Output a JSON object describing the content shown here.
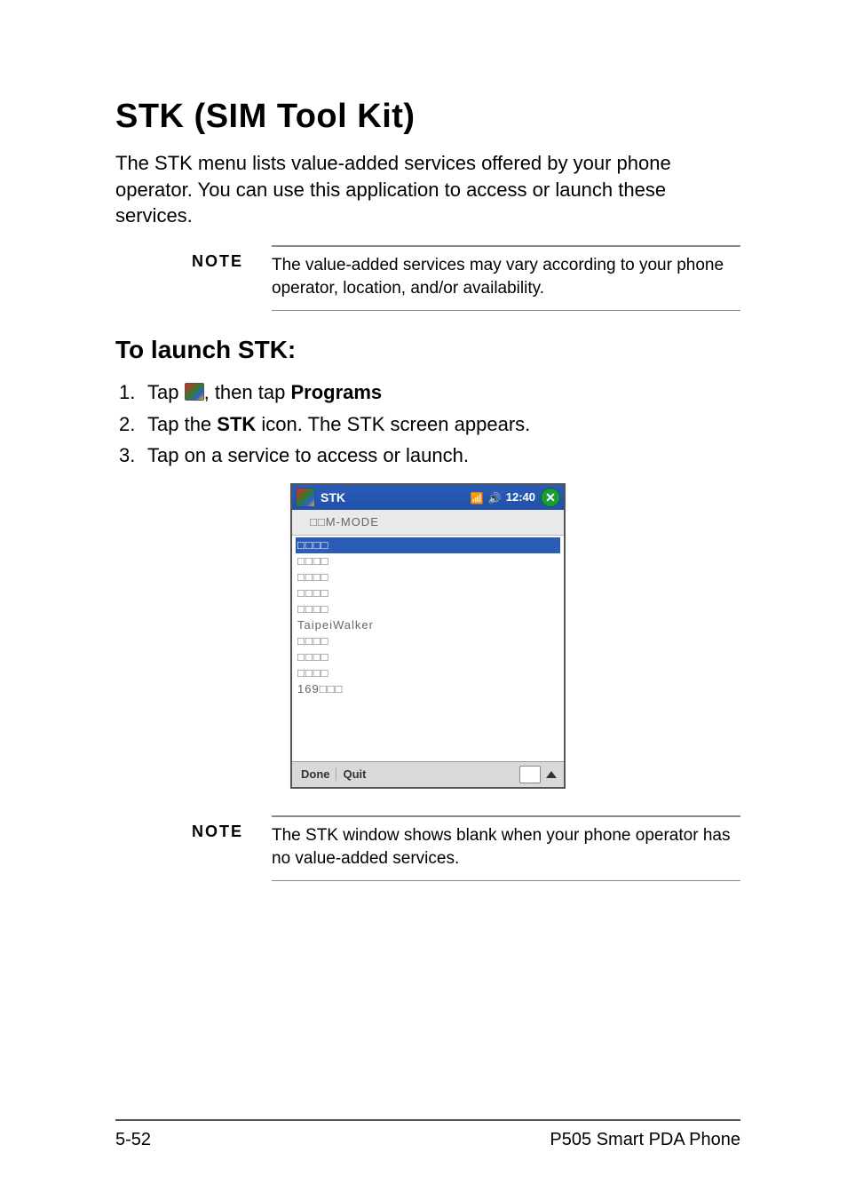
{
  "heading": "STK (SIM Tool Kit)",
  "intro": "The STK menu lists value-added services offered by your phone operator. You can use this application to access or launch these services.",
  "note1": {
    "label": "NOTE",
    "text": "The value-added services may vary according to your phone operator, location, and/or availability."
  },
  "subheading": "To launch STK:",
  "steps": {
    "s1a": "Tap ",
    "s1b": ", then tap ",
    "s1c": "Programs",
    "s2a": "Tap the ",
    "s2b": "STK",
    "s2c": " icon. The STK screen appears.",
    "s3": "Tap on a service to access or launch."
  },
  "pda": {
    "title": "STK",
    "time": "12:40",
    "sub": "□□M-MODE",
    "items": [
      "□□□□",
      "□□□□",
      "□□□□",
      "□□□□",
      "□□□□",
      "TaipeiWalker",
      "□□□□",
      "□□□□",
      "□□□□",
      "169□□□"
    ],
    "btn_done": "Done",
    "btn_quit": "Quit"
  },
  "note2": {
    "label": "NOTE",
    "text": "The STK window shows blank when your phone operator has no value-added services."
  },
  "footer": {
    "left": "5-52",
    "right": "P505 Smart PDA Phone"
  }
}
